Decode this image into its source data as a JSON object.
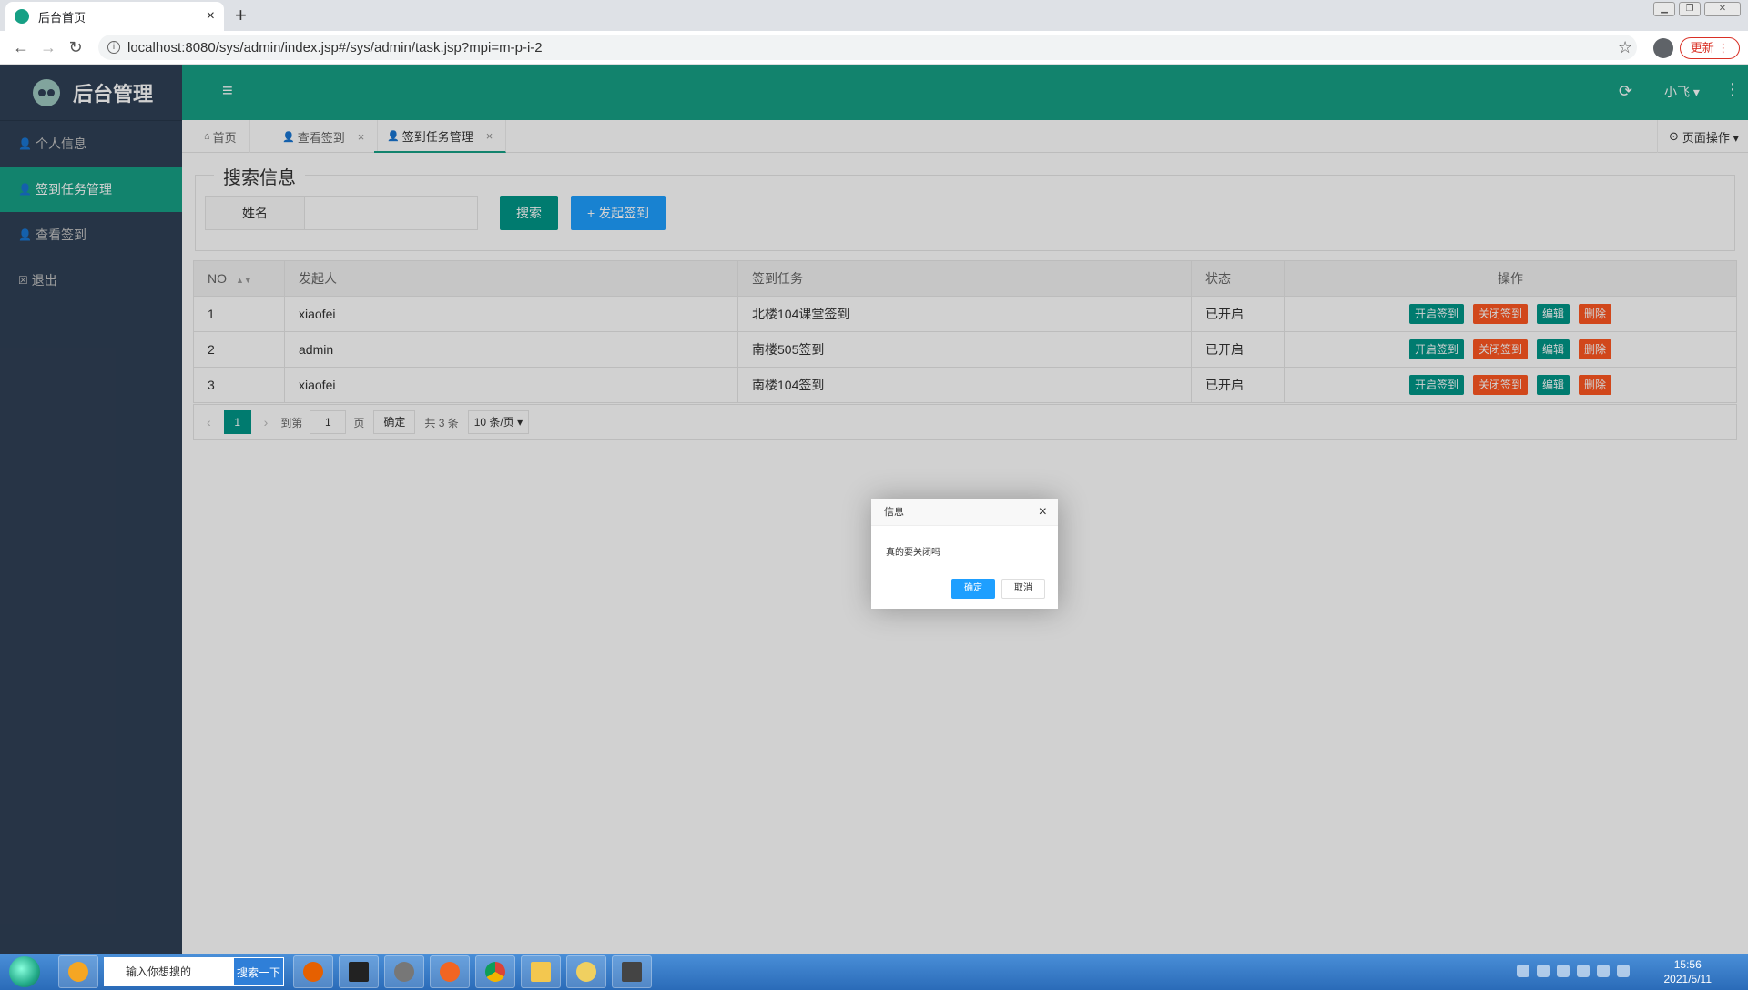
{
  "browser": {
    "tab_title": "后台首页",
    "tab_close": "×",
    "new_tab": "+",
    "url": "localhost:8080/sys/admin/index.jsp#/sys/admin/task.jsp?mpi=m-p-i-2",
    "back": "←",
    "forward": "→",
    "reload": "↻",
    "info": "i",
    "star": "☆",
    "update_label": "更新 ⋮"
  },
  "sidebar": {
    "brand": "后台管理",
    "items": [
      {
        "label": "个人信息",
        "icon": "user-icon",
        "active": false
      },
      {
        "label": "签到任务管理",
        "icon": "user-icon",
        "active": true
      },
      {
        "label": "查看签到",
        "icon": "user-icon",
        "active": false
      },
      {
        "label": "退出",
        "icon": "close-box-icon",
        "active": false
      }
    ]
  },
  "header": {
    "toggle": "≡",
    "refresh": "⟳",
    "user": "小飞 ▾",
    "more": "⋮"
  },
  "page_tabs": {
    "items": [
      {
        "label": "首页",
        "icon": "home-icon",
        "closable": false,
        "active": false
      },
      {
        "label": "查看签到",
        "icon": "user-icon",
        "closable": true,
        "active": false
      },
      {
        "label": "签到任务管理",
        "icon": "user-icon",
        "closable": true,
        "active": true
      }
    ],
    "close": "×",
    "page_ops": "页面操作 ▾"
  },
  "search": {
    "legend": "搜索信息",
    "name_label": "姓名",
    "search_button": "搜索",
    "add_button": "+ 发起签到"
  },
  "table": {
    "headers": [
      "NO",
      "发起人",
      "签到任务",
      "状态",
      "操作"
    ],
    "rows": [
      {
        "no": "1",
        "initiator": "xiaofei",
        "task": "北楼104课堂签到",
        "status": "已开启"
      },
      {
        "no": "2",
        "initiator": "admin",
        "task": "南楼505签到",
        "status": "已开启"
      },
      {
        "no": "3",
        "initiator": "xiaofei",
        "task": "南楼104签到",
        "status": "已开启"
      }
    ],
    "row_actions": [
      "开启签到",
      "关闭签到",
      "编辑",
      "删除"
    ]
  },
  "pager": {
    "prev": "‹",
    "current": "1",
    "next": "›",
    "goto_label": "到第",
    "goto_value": "1",
    "page_unit": "页",
    "confirm": "确定",
    "total": "共 3 条",
    "page_size": "10 条/页 ▾"
  },
  "dialog": {
    "title": "信息",
    "message": "真的要关闭吗",
    "ok": "确定",
    "cancel": "取消",
    "close": "×"
  },
  "taskbar": {
    "search_placeholder": "输入你想搜的",
    "search_button": "搜索一下",
    "time": "15:56",
    "date": "2021/5/11"
  },
  "colors": {
    "primary": "#16a085",
    "sidebar": "#2f4056",
    "danger": "#ff5722",
    "blue": "#1e9fff"
  }
}
